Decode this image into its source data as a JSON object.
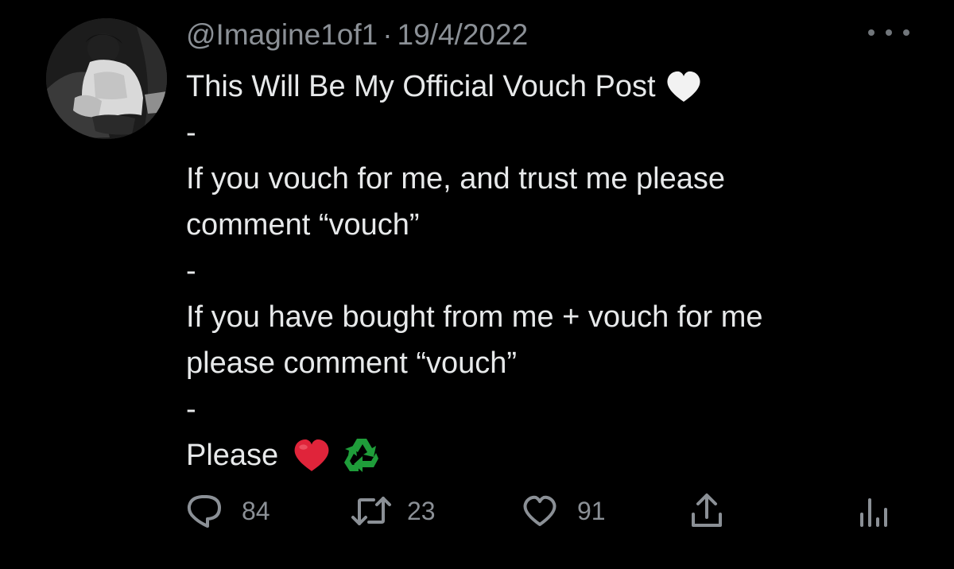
{
  "tweet": {
    "handle": "@Imagine1of1",
    "separator": "·",
    "date": "19/4/2022",
    "lines": [
      "This Will Be My Official Vouch Post",
      "-",
      "If you vouch for me, and trust me please",
      "comment “vouch”",
      "-",
      "If you have bought from me + vouch for me",
      "please comment “vouch”",
      "-",
      "Please"
    ],
    "emojis": [
      "white-heart-icon",
      "red-heart-icon",
      "recycling-symbol-icon"
    ]
  },
  "actions": {
    "reply_count": "84",
    "retweet_count": "23",
    "like_count": "91",
    "icons": [
      "reply-icon",
      "retweet-icon",
      "like-icon",
      "share-icon",
      "analytics-icon"
    ]
  },
  "colors": {
    "background": "#000000",
    "text": "#e7e9ea",
    "secondary": "#8b9096",
    "red_heart": "#e0243a",
    "recycle_green": "#1f9d3a"
  }
}
